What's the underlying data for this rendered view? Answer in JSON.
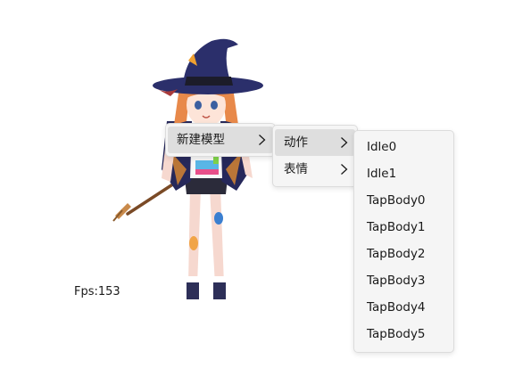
{
  "fps": {
    "label": "Fps:",
    "value": "153"
  },
  "context_menu": {
    "root": {
      "items": [
        {
          "label": "新建模型",
          "has_submenu": true,
          "active": true
        }
      ]
    },
    "model_submenu": {
      "items": [
        {
          "label": "动作",
          "has_submenu": true,
          "active": true
        },
        {
          "label": "表情",
          "has_submenu": true,
          "active": false
        }
      ]
    },
    "motion_submenu": {
      "items": [
        {
          "label": "Idle0"
        },
        {
          "label": "Idle1"
        },
        {
          "label": "TapBody0"
        },
        {
          "label": "TapBody1"
        },
        {
          "label": "TapBody2"
        },
        {
          "label": "TapBody3"
        },
        {
          "label": "TapBody4"
        },
        {
          "label": "TapBody5"
        }
      ]
    }
  },
  "icons": {
    "submenu_arrow": "chevron-right-icon"
  },
  "colors": {
    "menu_background": "#f5f5f5",
    "menu_hover": "#dedede",
    "menu_border": "#dcdcdc",
    "hat": "#2b2f6b",
    "hair": "#e8894a"
  }
}
